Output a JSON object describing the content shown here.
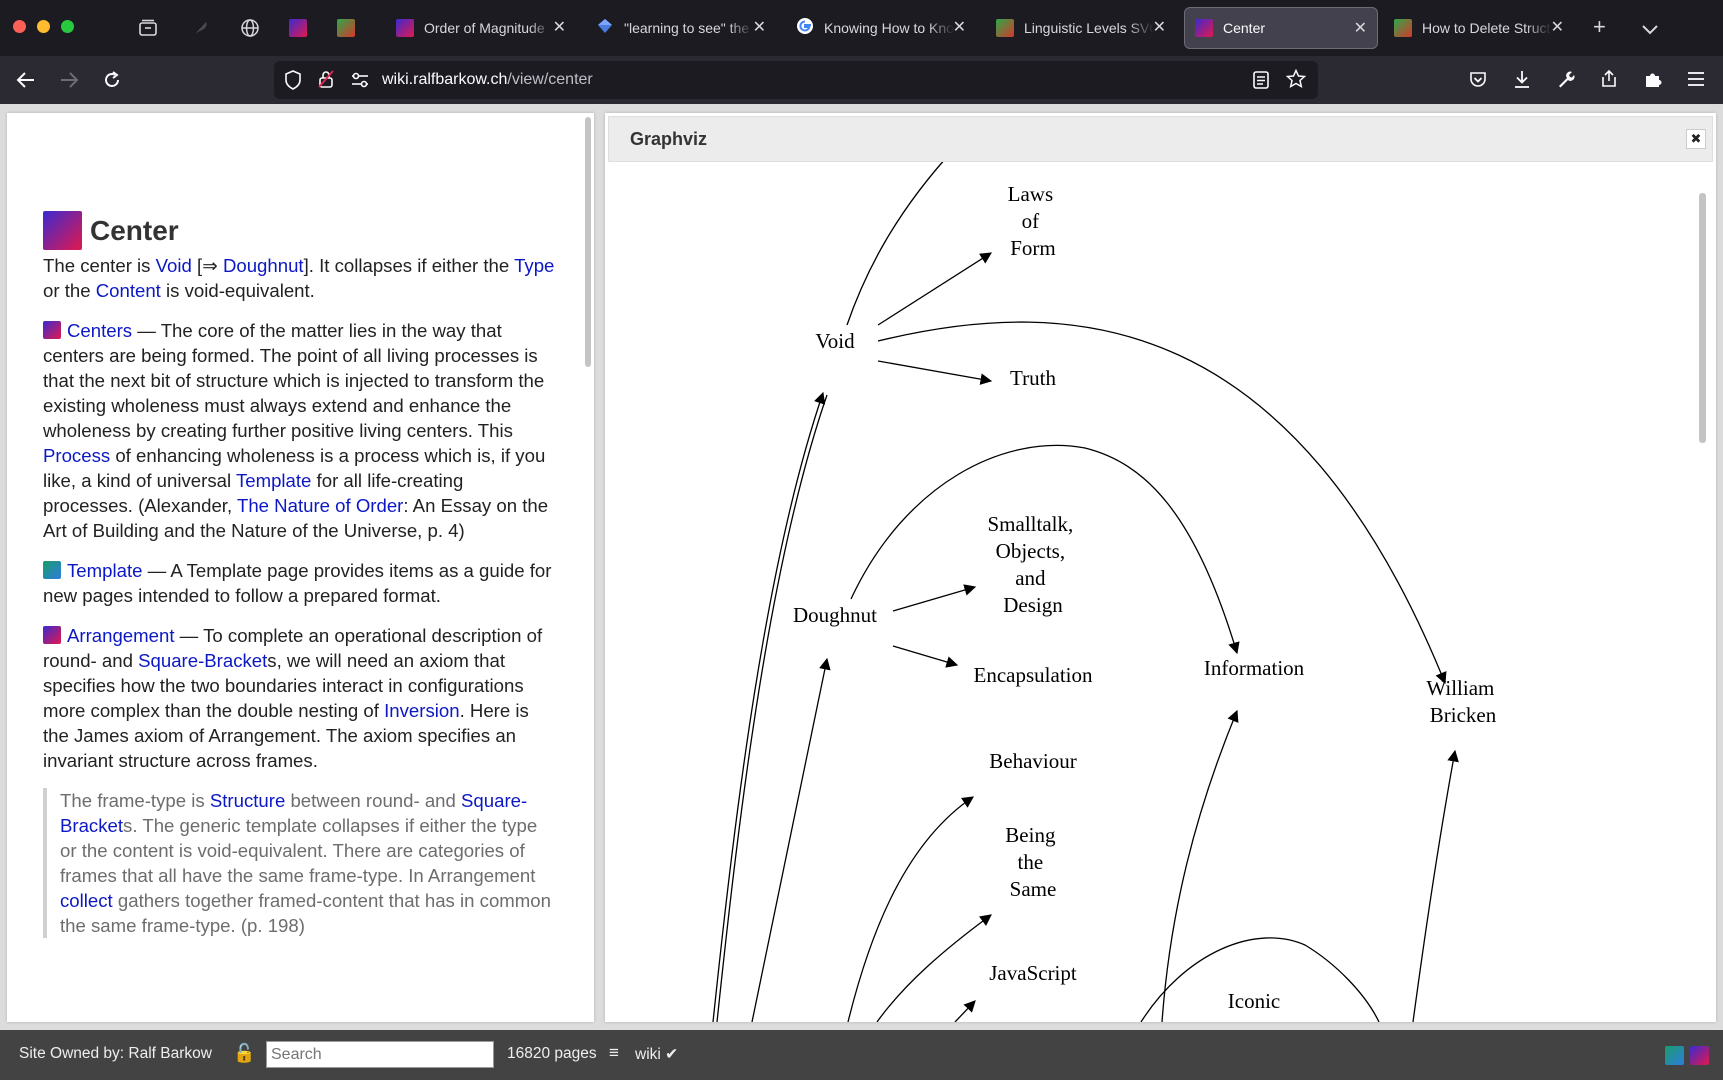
{
  "tabs": [
    {
      "title": "Order of Magnitude",
      "favicon": "purple-gradient-square"
    },
    {
      "title": "\"learning to see\" the",
      "favicon": "blue-diamond"
    },
    {
      "title": "Knowing How to Kno",
      "favicon": "google-g"
    },
    {
      "title": "Linguistic Levels SVG",
      "favicon": "green-red-square"
    },
    {
      "title": "Center",
      "favicon": "purple-gradient-square"
    },
    {
      "title": "How to Delete Struct",
      "favicon": "green-red-square"
    }
  ],
  "address": {
    "host": "wiki.ralfbarkow.ch",
    "path": "/view/center"
  },
  "left_page": {
    "title": "Center",
    "intro": {
      "t1": "The center is ",
      "void_link": "Void",
      "t2": " [⇒ ",
      "doughnut_link": "Doughnut",
      "t3": "]. It collapses if either the ",
      "type_link": "Type",
      "t4": " or the ",
      "content_link": "Content",
      "t5": " is void-equivalent."
    },
    "centers": {
      "link": "Centers",
      "t1": " — The core of the matter lies in the way that centers are being formed. The point of all living processes is that the next bit of structure which is injected to transform the existing wholeness must always extend and enhance the wholeness by creating further positive living centers. This ",
      "process_link": "Process",
      "t2": " of enhancing wholeness is a process which is, if you like, a kind of universal ",
      "template_link": "Template",
      "t3": " for all life-creating processes. (Alexander, ",
      "nature_link": "The Nature of Order",
      "t4": ": An Essay on the Art of Building and the Nature of the Universe, p. 4)"
    },
    "template": {
      "link": "Template",
      "t1": " — A Template page provides items as a guide for new pages intended to follow a prepared format."
    },
    "arrangement": {
      "link": "Arrangement",
      "t1": " — To complete an operational description of round- and ",
      "bracket_link": "Square-Bracket",
      "t2": "s, we will need an axiom that specifies how the two boundaries interact in configurations more complex than the double nesting of ",
      "inversion_link": "Inversion",
      "t3": ". Here is the James axiom of Arrangement. The axiom specifies an invariant structure across frames."
    },
    "quote": {
      "t1": "The frame-type is ",
      "structure_link": "Structure",
      "t2": " between round- and ",
      "bracket_link": "Square-Bracket",
      "t3": "s. The generic template collapses if either the type or the content is void-equivalent. There are categories of frames that all have the same frame-type. In Arrangement ",
      "collect_link": "collect",
      "t4": " gathers together framed-content that has in common the same frame-type. (p. 198)"
    }
  },
  "graphviz": {
    "title": "Graphviz",
    "close_label": "✖",
    "nodes": {
      "laws": [
        "Laws",
        "of",
        "Form"
      ],
      "void": "Void",
      "truth": "Truth",
      "smalltalk": [
        "Smalltalk,",
        "Objects,",
        "and",
        "Design"
      ],
      "doughnut": "Doughnut",
      "encapsulation": "Encapsulation",
      "information": "Information",
      "william": [
        "William",
        "Bricken"
      ],
      "behaviour": "Behaviour",
      "being": [
        "Being",
        "the",
        "Same"
      ],
      "javascript": "JavaScript",
      "iconic": "Iconic"
    }
  },
  "footer": {
    "owner": "Site Owned by: Ralf Barkow",
    "lock_icon": "🔓",
    "search_placeholder": "Search",
    "pages": "16820 pages",
    "menu_icon": "≡",
    "wiki": "wiki ✔"
  },
  "colors": {
    "link": "#0c18c4",
    "chrome_dark": "#1c1b22",
    "navbar": "#2b2a33",
    "footer": "#434343"
  }
}
